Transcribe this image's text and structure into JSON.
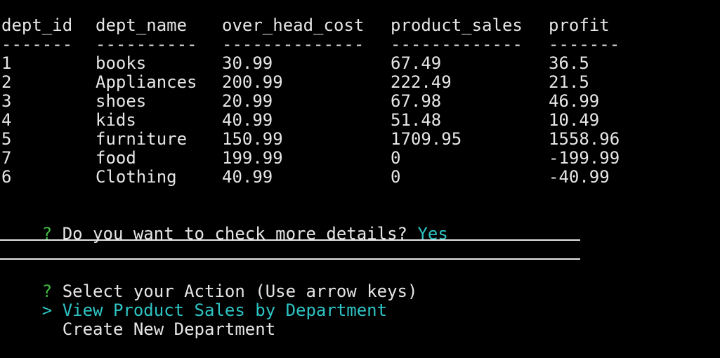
{
  "table": {
    "headers": [
      "dept_id",
      "dept_name",
      "over_head_cost",
      "product_sales",
      "profit"
    ],
    "dashes": [
      "-------",
      "----------",
      "--------------",
      "-------------",
      "-------"
    ],
    "rows": [
      [
        "1",
        "books",
        "30.99",
        "67.49",
        "36.5"
      ],
      [
        "2",
        "Appliances",
        "200.99",
        "222.49",
        "21.5"
      ],
      [
        "3",
        "shoes",
        "20.99",
        "67.98",
        "46.99"
      ],
      [
        "4",
        "kids",
        "40.99",
        "51.48",
        "10.49"
      ],
      [
        "5",
        "furniture",
        "150.99",
        "1709.95",
        "1558.96"
      ],
      [
        "7",
        "food",
        "199.99",
        "0",
        "-199.99"
      ],
      [
        "6",
        "Clothing",
        "40.99",
        "0",
        "-40.99"
      ]
    ]
  },
  "question1": {
    "marker": "?",
    "text": "Do you want to check more details?",
    "answer": "Yes"
  },
  "question2": {
    "marker": "?",
    "text": "Select your Action",
    "hint": "(Use arrow keys)"
  },
  "choices": {
    "pointer": ">",
    "selected": "View Product Sales by Department",
    "other": "Create New Department"
  },
  "colors": {
    "background": "#000000",
    "text": "#e6e6e6",
    "prompt_marker": "#3fbf3f",
    "highlight": "#2ec4c4"
  }
}
